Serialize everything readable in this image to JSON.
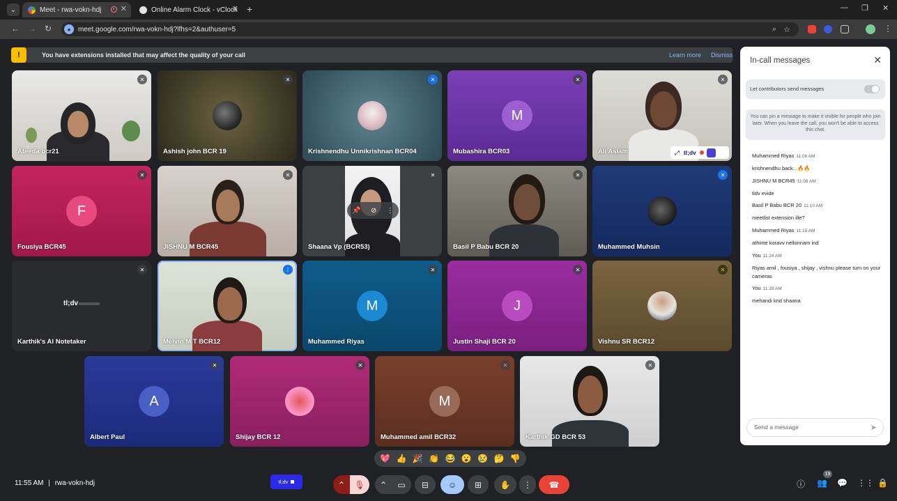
{
  "browser": {
    "tabs": [
      {
        "title": "Meet - rwa-vokn-hdj"
      },
      {
        "title": "Online Alarm Clock - vClock"
      }
    ],
    "url": "meet.google.com/rwa-vokn-hdj?lfhs=2&authuser=5"
  },
  "banner": {
    "text": "You have extensions installed that may affect the quality of your call",
    "learn_more": "Learn more",
    "dismiss": "Dismiss"
  },
  "tiles": {
    "t1": "Afeeda bcr21",
    "t2": "Ashish john BCR 19",
    "t3": "Krishnendhu Unnikrishnan BCR04",
    "t4": "Mubashira BCR03",
    "t4_initial": "M",
    "t5": "Ali Aslam",
    "t6": "Fousiya BCR45",
    "t6_initial": "F",
    "t7": "JISHNU M BCR45",
    "t8": "Shaana Vp (BCR53)",
    "t9": "Basil P Babu BCR 20",
    "t10": "Muhammed Muhsin",
    "t11": "Karthik's AI Notetaker",
    "t11_logo": "tl;dv",
    "t12": "Melvin M T BCR12",
    "t13": "Muhammed Riyas",
    "t13_initial": "M",
    "t14": "Justin Shaji BCR 20",
    "t14_initial": "J",
    "t15": "Vishnu SR BCR12",
    "t16": "Albert Paul",
    "t16_initial": "A",
    "t17": "Shijay BCR 12",
    "t18": "Muhammed amil BCR32",
    "t18_initial": "M",
    "t19": "Karthik GD BCR 53"
  },
  "tldv_badge": "tl;dv",
  "chat": {
    "title": "In-call messages",
    "permission_label": "Let contributors send messages",
    "pin_note": "You can pin a message to make it visible for people who join later. When you leave the call, you won't be able to access this chat.",
    "messages": [
      {
        "sender": "Muhammed Riyas",
        "time": "11:06 AM",
        "text": "krishnendhu back...🔥🔥"
      },
      {
        "sender": "JISHNU M BCR45",
        "time": "11:08 AM",
        "text": "tldv evide"
      },
      {
        "sender": "Basil P Babu BCR 20",
        "time": "11:10 AM",
        "text": "meetlist extension ille?"
      },
      {
        "sender": "Muhammed Riyas",
        "time": "11:15 AM",
        "text": "athinte koravv nellonnam ind"
      },
      {
        "sender": "You",
        "time": "11:24 AM",
        "text": "Riyas amil , fousiya , shijay , vishnu please turn on your cameras"
      },
      {
        "sender": "You",
        "time": "11:28 AM",
        "text": "mehandi knd shaana"
      }
    ],
    "input_placeholder": "Send a message"
  },
  "reactions": [
    "💖",
    "👍",
    "🎉",
    "👏",
    "😂",
    "😮",
    "😢",
    "🤔",
    "👎"
  ],
  "bottom": {
    "time": "11:55 AM",
    "separator": "|",
    "meeting_code": "rwa-vokn-hdj",
    "tldv_label": "tl;dv",
    "people_count": "19"
  }
}
